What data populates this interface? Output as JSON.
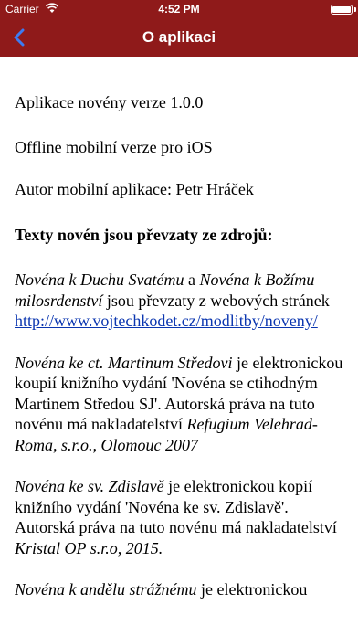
{
  "status_bar": {
    "carrier": "Carrier",
    "time": "4:52 PM",
    "battery_level": 1.0
  },
  "nav": {
    "back_icon": "chevron-left-icon",
    "title": "O aplikaci"
  },
  "colors": {
    "header_bg": "#8f1a1a",
    "link": "#0b36b0"
  },
  "content": {
    "version_line": "Aplikace novény verze 1.0.0",
    "offline_line": "Offline mobilní verze pro iOS",
    "author_line": "Autor mobilní aplikace: Petr Hráček",
    "sources_heading": "Texty novén jsou převzaty ze zdrojů:",
    "p1": {
      "t1": "Novéna k Duchu Svatému",
      "t2": " a ",
      "t3": "Novéna k Božímu milosrdenství",
      "t4": " jsou převzaty z webových stránek ",
      "link": "http://www.vojtechkodet.cz/modlitby/noveny/"
    },
    "p2": {
      "t1": "Novéna ke ct. Martinum Středovi",
      "t2": " je elektronickou koupií knižního vydání 'Novéna se ctihodným Martinem Středou SJ'. Autorská práva na tuto novénu má nakladatelství ",
      "t3": "Refugium Velehrad-Roma, s.r.o., Olomouc 2007"
    },
    "p3": {
      "t1": "Novéna ke sv. Zdislavě",
      "t2": " je elektronickou kopií knižního vydání 'Novéna ke sv. Zdislavě'. Autorská práva na tuto novénu má nakladatelství ",
      "t3": "Kristal OP s.r.o, 2015."
    },
    "p4": {
      "t1": "Novéna k andělu strážnému",
      "t2": " je elektronickou"
    }
  }
}
